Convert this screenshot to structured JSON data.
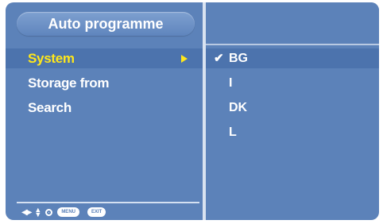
{
  "menu": {
    "title": "Auto programme",
    "items": [
      {
        "label": "System",
        "selected": true,
        "has_submenu": true
      },
      {
        "label": "Storage from",
        "selected": false
      },
      {
        "label": "Search",
        "selected": false
      }
    ]
  },
  "submenu": {
    "options": [
      {
        "label": "BG",
        "checked": true
      },
      {
        "label": "I",
        "checked": false
      },
      {
        "label": "DK",
        "checked": false
      },
      {
        "label": "L",
        "checked": false
      }
    ]
  },
  "footer": {
    "icons": [
      "left-right-arrows-icon",
      "up-down-arrows-icon",
      "ok-icon"
    ],
    "menu_button": "MENU",
    "exit_button": "EXIT"
  },
  "colors": {
    "panel_bg": "#5c82b9",
    "highlight_bg": "#4c73ad",
    "selected_text": "#ffe71a",
    "text": "#ffffff"
  }
}
